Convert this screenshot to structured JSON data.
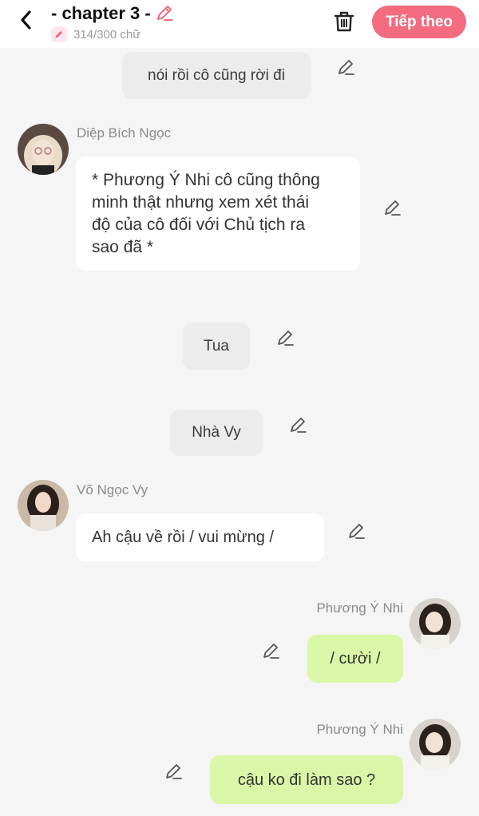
{
  "header": {
    "title": "- chapter 3 -",
    "char_count": "314/300 chữ",
    "next_label": "Tiếp theo",
    "accent": "#f26b7f"
  },
  "messages": [
    {
      "type": "narration",
      "text": "nói rồi cô cũng rời đi"
    },
    {
      "type": "left",
      "sender": "Diệp Bích Ngọc",
      "lines": [
        "* Phương Ý Nhi cô cũng thông",
        "minh thật nhưng xem xét thái",
        "độ của cô đối với Chủ tịch ra",
        "sao đã *"
      ]
    },
    {
      "type": "narration",
      "text": "Tua"
    },
    {
      "type": "narration",
      "text": "Nhà Vy"
    },
    {
      "type": "left",
      "sender": "Võ Ngọc Vy",
      "text": "Ah cậu về rồi / vui mừng /"
    },
    {
      "type": "right",
      "sender": "Phương Ý Nhi",
      "text": "/ cười /"
    },
    {
      "type": "right",
      "sender": "Phương Ý Nhi",
      "text": "cậu ko đi làm sao ?"
    }
  ],
  "icons": {
    "back": "chevron-left-icon",
    "edit": "pencil-icon",
    "delete": "trash-icon"
  },
  "colors": {
    "background": "#f5f5f5",
    "narration_bubble": "#ececec",
    "left_bubble": "#ffffff",
    "right_bubble": "#d9f7a6"
  }
}
